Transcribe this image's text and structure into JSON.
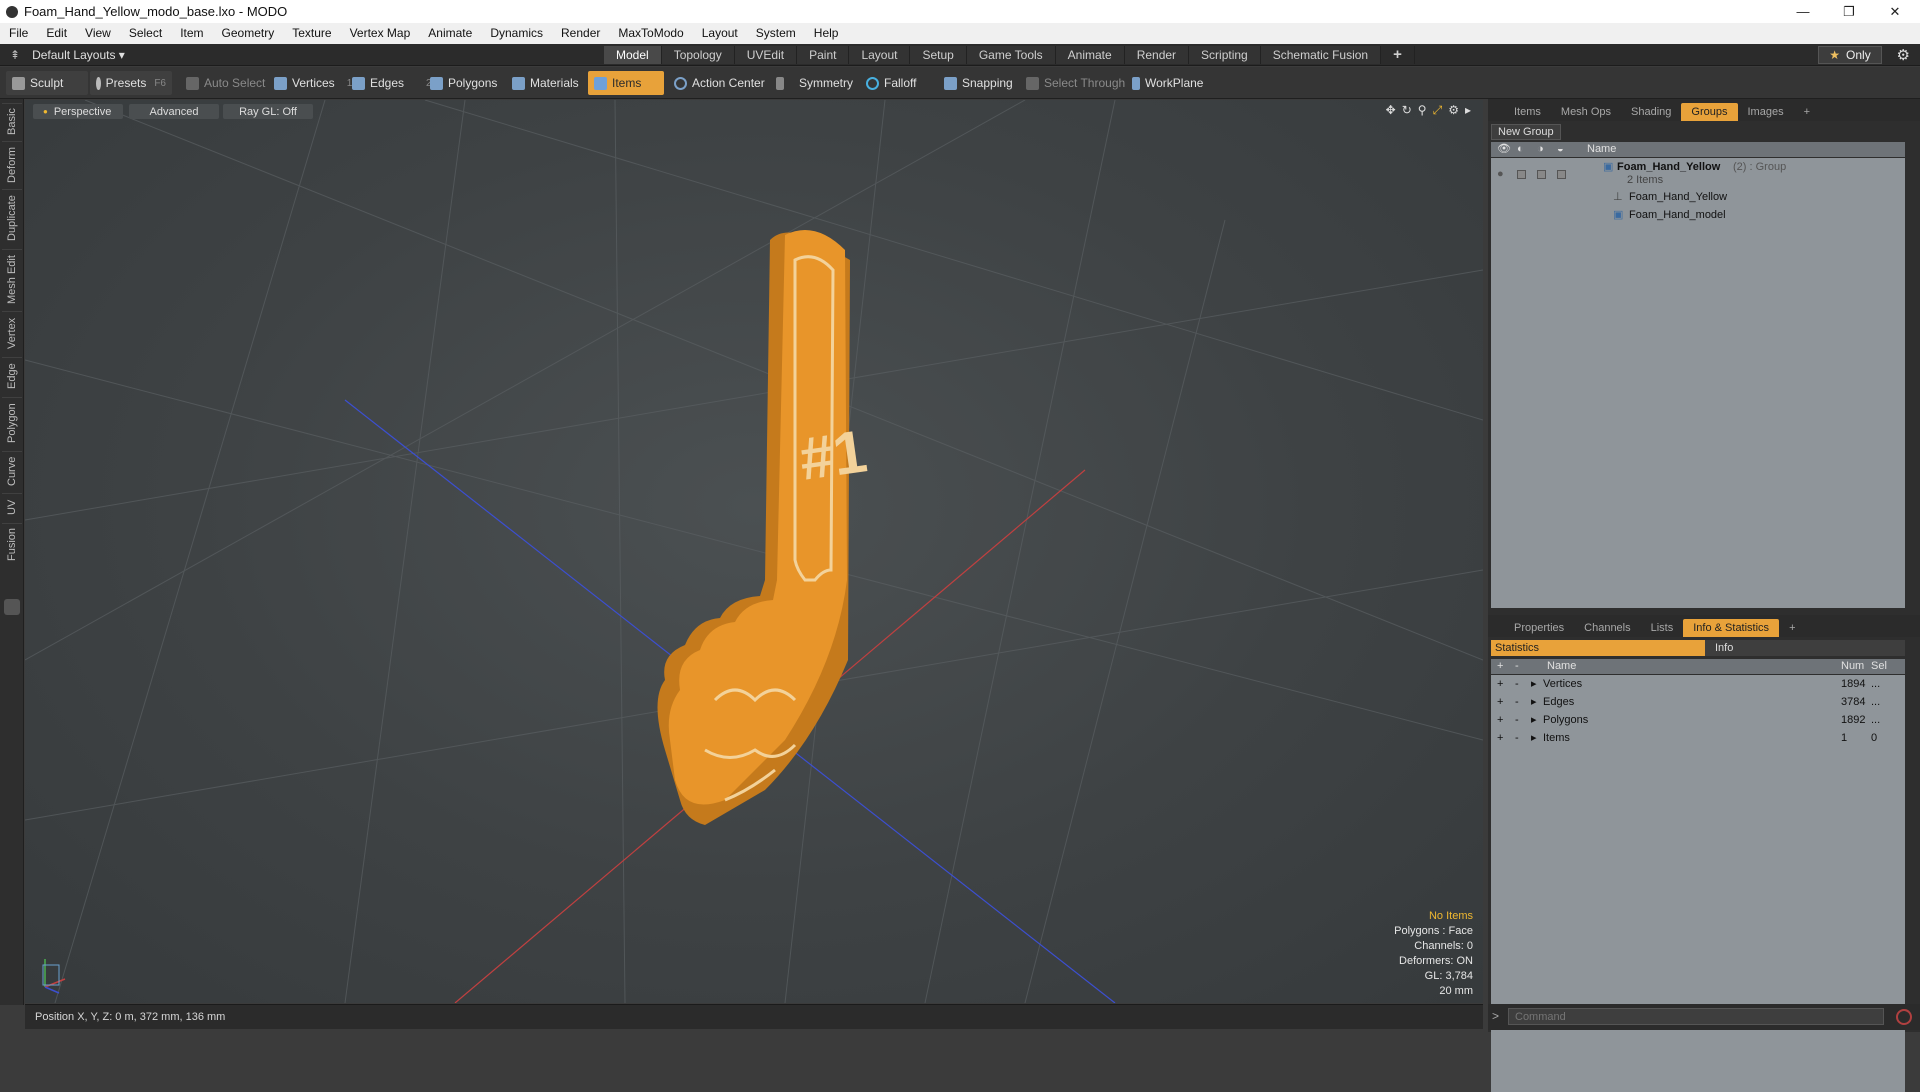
{
  "window": {
    "title": "Foam_Hand_Yellow_modo_base.lxo - MODO",
    "minimize": "—",
    "maximize": "❐",
    "close": "✕"
  },
  "menu": [
    "File",
    "Edit",
    "View",
    "Select",
    "Item",
    "Geometry",
    "Texture",
    "Vertex Map",
    "Animate",
    "Dynamics",
    "Render",
    "MaxToModo",
    "Layout",
    "System",
    "Help"
  ],
  "layout": {
    "selector": "Default Layouts ▾",
    "tabs": [
      "Model",
      "Topology",
      "UVEdit",
      "Paint",
      "Layout",
      "Setup",
      "Game Tools",
      "Animate",
      "Render",
      "Scripting",
      "Schematic Fusion"
    ],
    "active_tab": "Model",
    "add": "+",
    "only": "Only"
  },
  "toolbar": {
    "sculpt": "Sculpt",
    "presets": "Presets",
    "presets_key": "F6",
    "auto_select": "Auto Select",
    "vertices": "Vertices",
    "vertices_count": "1",
    "edges": "Edges",
    "edges_count": "2",
    "polygons": "Polygons",
    "materials": "Materials",
    "items": "Items",
    "action_center": "Action Center",
    "symmetry": "Symmetry",
    "falloff": "Falloff",
    "snapping": "Snapping",
    "select_through": "Select Through",
    "workplane": "WorkPlane"
  },
  "left_tabs": [
    "Basic",
    "Deform",
    "Duplicate",
    "Mesh Edit",
    "Vertex",
    "Edge",
    "Polygon",
    "Curve",
    "UV",
    "Fusion"
  ],
  "viewport": {
    "view": "Perspective",
    "shading": "Advanced",
    "raygl": "Ray GL: Off",
    "hud": {
      "items": "No Items",
      "polygons": "Polygons : Face",
      "channels": "Channels: 0",
      "deformers": "Deformers: ON",
      "gl": "GL: 3,784",
      "scale": "20 mm"
    },
    "model_text": "#1"
  },
  "status": {
    "position": "Position X, Y, Z:  0 m, 372 mm, 136 mm"
  },
  "groups_panel": {
    "tabs": [
      "Items",
      "Mesh Ops",
      "Shading",
      "Groups",
      "Images"
    ],
    "active": "Groups",
    "add": "+",
    "new_group": "New Group",
    "col_name": "Name",
    "rows": [
      {
        "label": "Foam_Hand_Yellow",
        "extra": "(2) : Group",
        "sub": "2 Items"
      },
      {
        "label": "Foam_Hand_Yellow"
      },
      {
        "label": "Foam_Hand_model"
      }
    ]
  },
  "stats_panel": {
    "tabs": [
      "Properties",
      "Channels",
      "Lists",
      "Info & Statistics"
    ],
    "active": "Info & Statistics",
    "add": "+",
    "sub_tabs": [
      "Statistics",
      "Info"
    ],
    "headers": {
      "name": "Name",
      "num": "Num",
      "sel": "Sel"
    },
    "rows": [
      {
        "name": "Vertices",
        "num": "1894",
        "sel": "..."
      },
      {
        "name": "Edges",
        "num": "3784",
        "sel": "..."
      },
      {
        "name": "Polygons",
        "num": "1892",
        "sel": "..."
      },
      {
        "name": "Items",
        "num": "1",
        "sel": "0"
      }
    ]
  },
  "command": {
    "placeholder": "Command",
    "prompt": ">"
  },
  "colors": {
    "accent": "#e8a23a",
    "foam": "#e8952a"
  }
}
